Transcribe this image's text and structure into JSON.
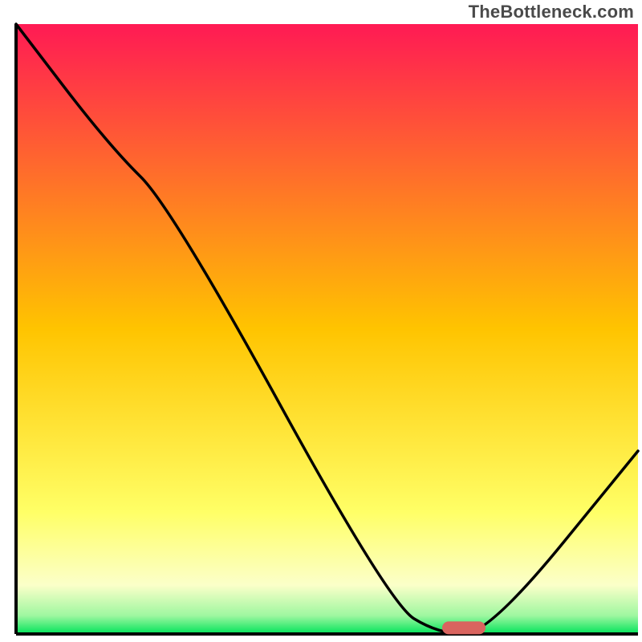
{
  "watermark": "TheBottleneck.com",
  "chart_data": {
    "type": "line",
    "title": "",
    "xlabel": "",
    "ylabel": "",
    "xlim": [
      0,
      100
    ],
    "ylim": [
      0,
      100
    ],
    "x": [
      0,
      15,
      25,
      60,
      68,
      76,
      100
    ],
    "values": [
      100,
      80,
      70,
      5,
      0,
      0,
      30
    ],
    "annotations": [],
    "marker": {
      "x": 72,
      "y": 1,
      "color": "#d9645f"
    },
    "gradient_stops": [
      {
        "pos": 0.0,
        "color": "#ff1a54"
      },
      {
        "pos": 0.5,
        "color": "#ffc400"
      },
      {
        "pos": 0.8,
        "color": "#ffff66"
      },
      {
        "pos": 0.92,
        "color": "#fbffc9"
      },
      {
        "pos": 0.97,
        "color": "#9ef7a0"
      },
      {
        "pos": 1.0,
        "color": "#00e35a"
      }
    ],
    "curve_color": "#000000",
    "axis_color": "#000000",
    "note": "Axes have no visible tick labels; data values are read as percentages of the plot area (0 = bottom/left, 100 = top/right). Curve shows a steep monotone descent with a slight inflection near x≈25, reaches a flat minimum around x≈68–76 at y≈0, then rises to y≈30 at the right edge."
  }
}
